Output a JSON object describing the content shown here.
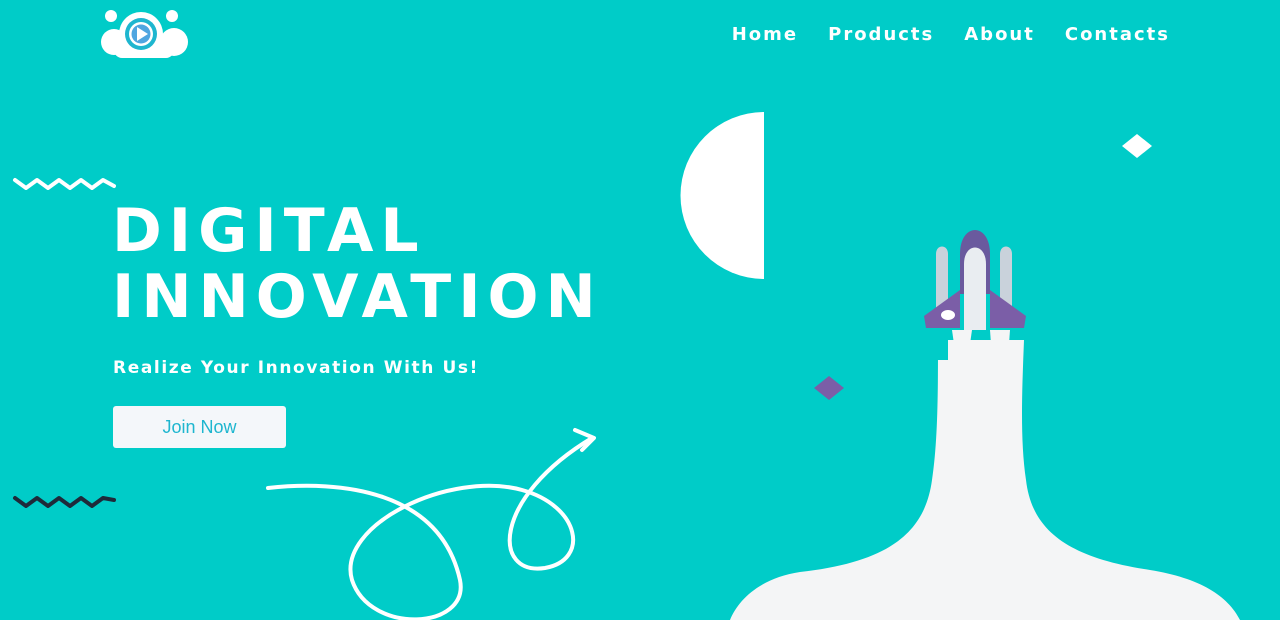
{
  "nav": {
    "items": [
      "Home",
      "Products",
      "About",
      "Contacts"
    ]
  },
  "hero": {
    "title_line1": "DIGITAL",
    "title_line2": "INNOVATION",
    "tagline": "Realize Your Innovation With Us!",
    "cta_label": "Join Now"
  },
  "icons": {
    "logo": "cloud-play-logo",
    "rocket": "rocket-icon"
  },
  "colors": {
    "background": "#00CCC8",
    "text": "#FFFFFF",
    "button_bg": "#F4F7FA",
    "button_text": "#1EB6CF",
    "accent_purple": "#7B5EA7",
    "dark_zigzag": "#1E2A3A",
    "smoke": "#F4F5F6"
  }
}
